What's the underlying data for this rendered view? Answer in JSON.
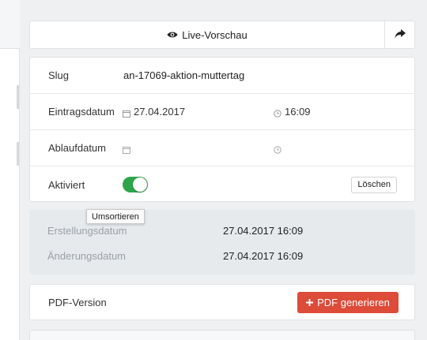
{
  "preview": {
    "label": "Live-Vorschau",
    "icon": "eye-icon",
    "share_icon": "share-arrow-icon"
  },
  "fields": {
    "slug": {
      "label": "Slug",
      "value": "an-17069-aktion-muttertag"
    },
    "entry_date": {
      "label": "Eintragsdatum",
      "date": "27.04.2017",
      "time": "16:09"
    },
    "expiry_date": {
      "label": "Ablaufdatum",
      "date": "",
      "time": ""
    },
    "activated": {
      "label": "Aktiviert",
      "enabled": true,
      "delete_label": "Löschen"
    }
  },
  "tooltip": "Umsortieren",
  "meta": {
    "created": {
      "label": "Erstellungsdatum",
      "value": "27.04.2017 16:09"
    },
    "modified": {
      "label": "Änderungsdatum",
      "value": "27.04.2017 16:09"
    }
  },
  "pdf": {
    "label": "PDF-Version",
    "button_label": "PDF generieren",
    "button_color": "#dd4b39"
  },
  "colors": {
    "toggle_on": "#2ea54a",
    "background": "#eef0f2"
  }
}
